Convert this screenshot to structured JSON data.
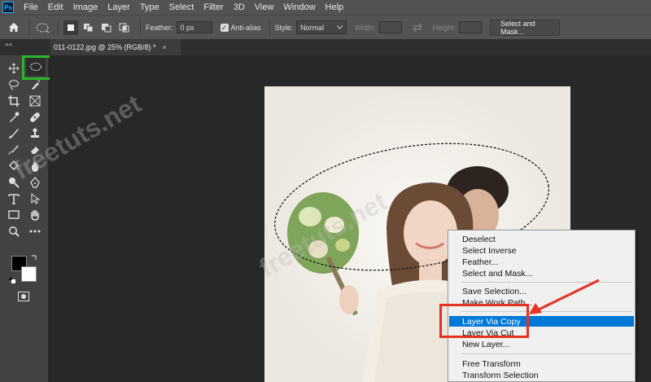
{
  "app": {
    "logo": "Ps"
  },
  "menubar": {
    "items": [
      "File",
      "Edit",
      "Image",
      "Layer",
      "Type",
      "Select",
      "Filter",
      "3D",
      "View",
      "Window",
      "Help"
    ]
  },
  "options": {
    "feather_label": "Feather:",
    "feather_value": "0 px",
    "antialias_label": "Anti-alias",
    "antialias_checked": true,
    "style_label": "Style:",
    "style_value": "Normal",
    "width_label": "Width:",
    "height_label": "Height:",
    "select_mask_label": "Select and Mask..."
  },
  "document_tab": {
    "title": "011-0122.jpg @ 25% (RGB/8) *",
    "close_glyph": "×"
  },
  "toolbox": {
    "collapse_glyph": "««"
  },
  "context_menu": {
    "items": [
      "Deselect",
      "Select Inverse",
      "Feather...",
      "Select and Mask...",
      "Save Selection...",
      "Make Work Path...",
      "Layer Via Copy",
      "Layer Via Cut",
      "New Layer...",
      "Free Transform",
      "Transform Selection"
    ],
    "highlighted": "Layer Via Copy"
  },
  "watermark": {
    "text": "freetuts.net"
  },
  "colors": {
    "highlight": "#0078d7",
    "annotation_red": "#e53222",
    "annotation_green": "#2bb52b"
  }
}
